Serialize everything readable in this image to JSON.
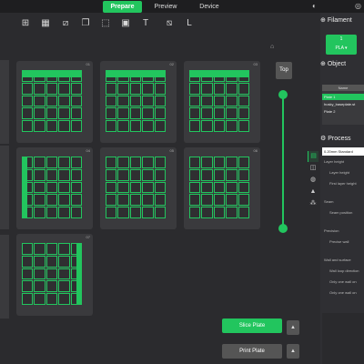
{
  "topbar": {
    "tabs": [
      {
        "label": "Prepare",
        "active": true
      },
      {
        "label": "Preview",
        "active": false
      },
      {
        "label": "Device",
        "active": false
      }
    ],
    "icons": [
      "headset-icon",
      "globe-icon"
    ]
  },
  "toolbar": {
    "tools": [
      "add-icon",
      "grid-icon",
      "split-icon",
      "copy-icon",
      "cube-icon",
      "layers-icon",
      "text-icon",
      "cut-icon",
      "sketch-icon"
    ]
  },
  "plates": [
    {
      "num": "01",
      "style": "top"
    },
    {
      "num": "02",
      "style": "top"
    },
    {
      "num": "03",
      "style": "top"
    },
    {
      "num": "04",
      "style": "left"
    },
    {
      "num": "05",
      "style": "none"
    },
    {
      "num": "06",
      "style": "none"
    },
    {
      "num": "07",
      "style": "right"
    }
  ],
  "canvas": {
    "top_button": "Top"
  },
  "actions": {
    "slice_label": "Slice Plate",
    "print_label": "Print Plate",
    "arrow": "▲"
  },
  "right_panel": {
    "filament_title": "Filament",
    "filament_slot": "1",
    "filament_type": "PLA ▾",
    "object_title": "Object",
    "object_header": "Name",
    "objects": [
      "Plate 1",
      "husky_baseplate.st",
      "Plate 2"
    ],
    "process_title": "Process",
    "preset": "0.20mm Standard",
    "settings": [
      "Layer height",
      "Layer height",
      "First layer height",
      "Seam",
      "Seam position",
      "Precision",
      "Precise wall",
      "Wall and surface",
      "Wall loop direction",
      "Only one wall on",
      "Only one wall on"
    ]
  }
}
